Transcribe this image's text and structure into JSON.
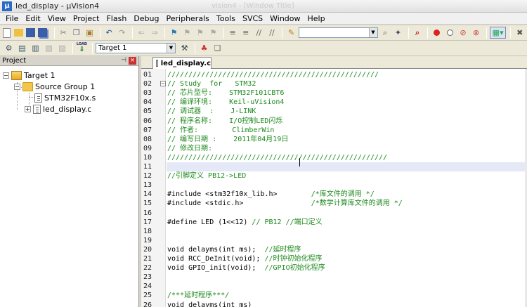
{
  "window": {
    "title": "led_display - µVision4",
    "ghost_title": "vision4 - [Window Title]"
  },
  "menu": [
    "File",
    "Edit",
    "View",
    "Project",
    "Flash",
    "Debug",
    "Peripherals",
    "Tools",
    "SVCS",
    "Window",
    "Help"
  ],
  "toolbar": {
    "search_value": "",
    "target_value": "Target 1",
    "load_label": "LOAD"
  },
  "project": {
    "header": "Project",
    "tree": {
      "target": "Target 1",
      "group": "Source Group 1",
      "files": [
        "STM32F10x.s",
        "led_display.c"
      ]
    }
  },
  "editor": {
    "tab": "led_display.c",
    "current_line": 11,
    "lines": [
      {
        "n": "01",
        "text": "//////////////////////////////////////////////////",
        "cls": "cm"
      },
      {
        "n": "02",
        "text": "// Study  for   STM32",
        "cls": "cm",
        "fold": "−"
      },
      {
        "n": "03",
        "text": "// 芯片型号:    STM32F101CBT6",
        "cls": "cm"
      },
      {
        "n": "04",
        "text": "// 编译环境:    Keil-uVision4",
        "cls": "cm"
      },
      {
        "n": "05",
        "text": "// 调试器  :    J-LINK",
        "cls": "cm"
      },
      {
        "n": "06",
        "text": "// 程序名称:    I/O控制LED闪烁",
        "cls": "cm"
      },
      {
        "n": "07",
        "text": "// 作者:        ClimberWin",
        "cls": "cm"
      },
      {
        "n": "08",
        "text": "// 编写日期 :    2011年04月19日",
        "cls": "cm"
      },
      {
        "n": "09",
        "text": "// 修改日期:",
        "cls": "cm"
      },
      {
        "n": "10",
        "text": "////////////////////////////////////////////////////",
        "cls": "cm"
      },
      {
        "n": "11",
        "text": "",
        "cls": "pl"
      },
      {
        "n": "12",
        "text": "//引脚定义 PB12->LED",
        "cls": "cm"
      },
      {
        "n": "13",
        "text": "",
        "cls": "pl"
      },
      {
        "n": "14",
        "text": "#include <stm32f10x_lib.h>        /*库文件的调用 */",
        "cls": "pl",
        "comment_start": 34
      },
      {
        "n": "15",
        "text": "#include <stdic.h>                /*数学计算库文件的调用 */",
        "cls": "pl",
        "comment_start": 34
      },
      {
        "n": "16",
        "text": "",
        "cls": "pl"
      },
      {
        "n": "17",
        "text": "#define LED (1<<12) // PB12 //端口定义",
        "cls": "pl",
        "comment_start": 20
      },
      {
        "n": "18",
        "text": "",
        "cls": "pl"
      },
      {
        "n": "19",
        "text": "",
        "cls": "pl"
      },
      {
        "n": "20",
        "text": "void delayms(int ms);  //延时程序",
        "cls": "pl",
        "comment_start": 23
      },
      {
        "n": "21",
        "text": "void RCC_DeInit(void); //时钟初始化程序",
        "cls": "pl",
        "comment_start": 23
      },
      {
        "n": "22",
        "text": "void GPIO_init(void);  //GPIO初始化程序",
        "cls": "pl",
        "comment_start": 23
      },
      {
        "n": "23",
        "text": "",
        "cls": "pl"
      },
      {
        "n": "24",
        "text": "",
        "cls": "pl"
      },
      {
        "n": "25",
        "text": "/***延时程序***/",
        "cls": "cm"
      },
      {
        "n": "26",
        "text": "void delayms(int ms)",
        "cls": "pl"
      },
      {
        "n": "27",
        "text": "{",
        "cls": "pl"
      }
    ]
  }
}
